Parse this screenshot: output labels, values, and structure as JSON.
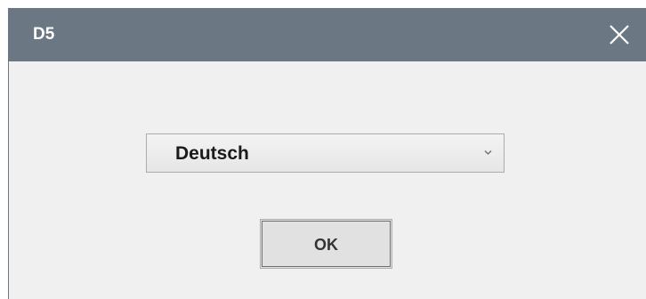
{
  "window": {
    "title": "D5",
    "titlebar_color": "#6c7784",
    "close_icon": "close-icon"
  },
  "language_select": {
    "selected": "Deutsch",
    "arrow_icon": "chevron-down-icon"
  },
  "ok_button": {
    "label": "OK"
  }
}
